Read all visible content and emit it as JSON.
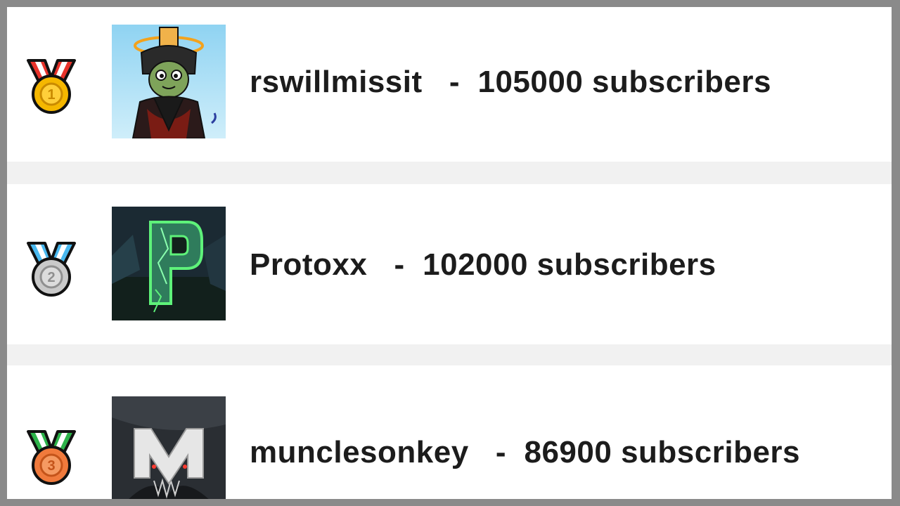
{
  "leaderboard": [
    {
      "rank": 1,
      "medal_icon": "gold-medal-icon",
      "ribbon_color": "#e8332b",
      "medal_color": "#f5b700",
      "avatar_icon": "red-robed-character-avatar",
      "name": "rswillmissit",
      "separator": "-",
      "subscribers": "105000 subscribers"
    },
    {
      "rank": 2,
      "medal_icon": "silver-medal-icon",
      "ribbon_color": "#49b8ef",
      "medal_color": "#c9c9c9",
      "avatar_icon": "green-letter-p-avatar",
      "name": "Protoxx",
      "separator": "-",
      "subscribers": "102000 subscribers"
    },
    {
      "rank": 3,
      "medal_icon": "bronze-medal-icon",
      "ribbon_color": "#2db34a",
      "medal_color": "#f07a3c",
      "avatar_icon": "letter-m-avatar",
      "name": "muncleson​key",
      "separator": "-",
      "subscribers": "86900 subscribers"
    }
  ]
}
